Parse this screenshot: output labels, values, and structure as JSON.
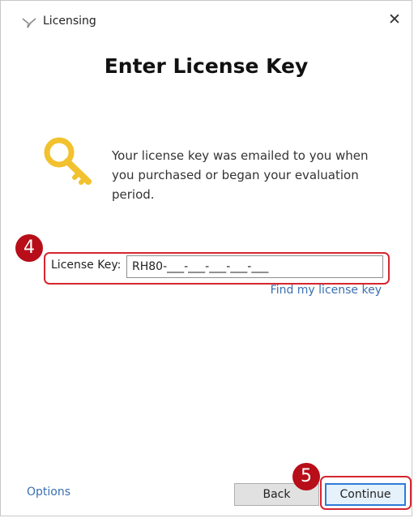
{
  "window": {
    "title": "Licensing",
    "close_glyph": "✕"
  },
  "heading": "Enter License Key",
  "info": {
    "text": "Your license key was emailed to you when you purchased or began your evaluation period.",
    "icon": "key-icon"
  },
  "license": {
    "label": "License Key:",
    "value": "RH80-___-___-___-___-___",
    "find_link": "Find my license key"
  },
  "annotations": {
    "step_4": "4",
    "step_5": "5",
    "highlight_color": "#d5262f",
    "badge_color": "#b70e19"
  },
  "footer": {
    "options_label": "Options",
    "back_label": "Back",
    "continue_label": "Continue"
  },
  "colors": {
    "link": "#3a6fb0",
    "key": "#f2c12e",
    "default_button_border": "#2f7bd6"
  }
}
